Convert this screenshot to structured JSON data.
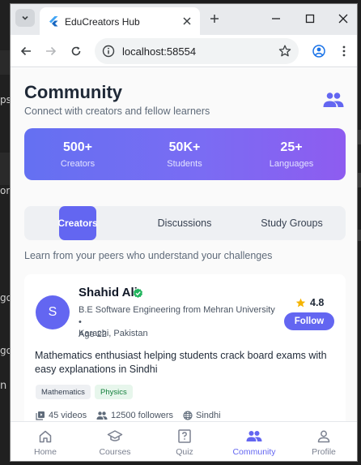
{
  "background": {
    "peek_fragments": [
      "ps",
      "ore",
      "go",
      "go",
      "n L"
    ]
  },
  "browser": {
    "tab_title": "EduCreators Hub",
    "url": "localhost:58554"
  },
  "header": {
    "title": "Community",
    "subtitle": "Connect with creators and fellow learners",
    "icon": "people-icon"
  },
  "stats": [
    {
      "value": "500+",
      "label": "Creators"
    },
    {
      "value": "50K+",
      "label": "Students"
    },
    {
      "value": "25+",
      "label": "Languages"
    }
  ],
  "tabs": [
    {
      "label": "Creators",
      "active": true
    },
    {
      "label": "Discussions",
      "active": false
    },
    {
      "label": "Study Groups",
      "active": false
    }
  ],
  "tagline": "Learn from your peers who understand your challenges",
  "creator": {
    "initial": "S",
    "name": "Shahid Ali",
    "verified": true,
    "education": "B.E Software Engineering from Mehran University •",
    "age": "Age 22",
    "location": "Karachi, Pakistan",
    "rating": "4.8",
    "follow_label": "Follow",
    "bio": "Mathematics enthusiast helping students crack board exams with easy explanations in Sindhi",
    "subjects": [
      "Mathematics",
      "Physics"
    ],
    "videos": "45 videos",
    "followers": "12500 followers",
    "language": "Sindhi"
  },
  "bottom_nav": [
    {
      "label": "Home",
      "icon": "home-icon",
      "active": false
    },
    {
      "label": "Courses",
      "icon": "school-icon",
      "active": false
    },
    {
      "label": "Quiz",
      "icon": "quiz-icon",
      "active": false
    },
    {
      "label": "Community",
      "icon": "people-icon",
      "active": true
    },
    {
      "label": "Profile",
      "icon": "person-icon",
      "active": false
    }
  ],
  "colors": {
    "accent": "#6366f1",
    "gradient_start": "#6470f2",
    "gradient_end": "#8e5cf0",
    "verified": "#22b55e",
    "star": "#f5b400",
    "physics_chip": "#15803d"
  }
}
